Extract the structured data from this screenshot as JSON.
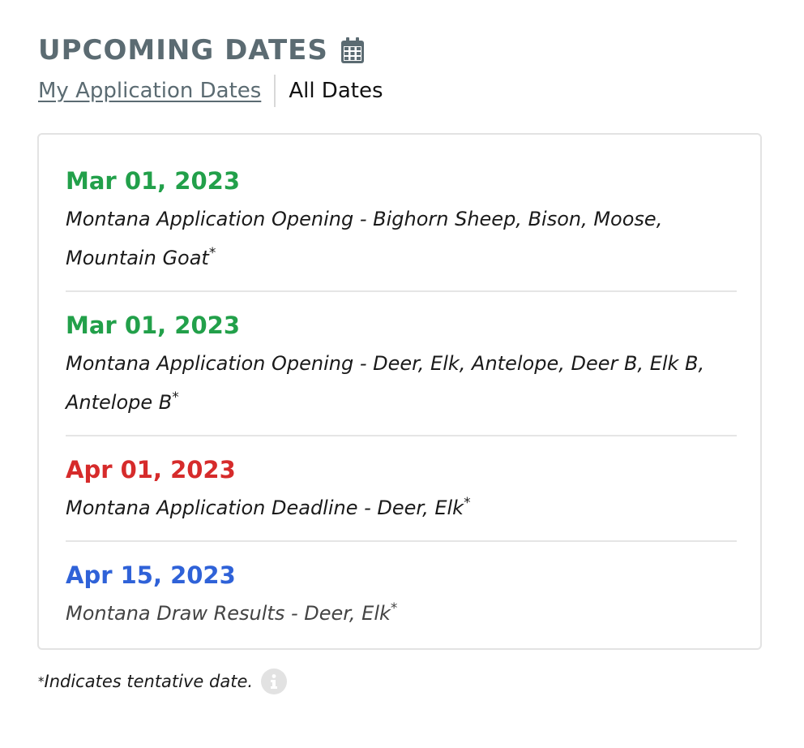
{
  "header": {
    "title": "UPCOMING DATES",
    "icon": "calendar-icon"
  },
  "tabs": {
    "my_dates_label": "My Application Dates",
    "all_dates_label": "All Dates",
    "active": "All Dates"
  },
  "colors": {
    "title": "#5b6b72",
    "opening": "#22a04a",
    "deadline": "#d62b2b",
    "results": "#2f62d8"
  },
  "entries": [
    {
      "date": "Mar 01, 2023",
      "description": "Montana Application Opening - Bighorn Sheep, Bison, Moose, Mountain Goat",
      "marker": "*",
      "kind": "opening"
    },
    {
      "date": "Mar 01, 2023",
      "description": "Montana Application Opening - Deer, Elk, Antelope, Deer B, Elk B, Antelope B",
      "marker": "*",
      "kind": "opening"
    },
    {
      "date": "Apr 01, 2023",
      "description": "Montana Application Deadline - Deer, Elk",
      "marker": "*",
      "kind": "deadline"
    },
    {
      "date": "Apr 15, 2023",
      "description": "Montana Draw Results - Deer, Elk",
      "marker": "*",
      "kind": "results"
    }
  ],
  "footnote": {
    "marker": "*",
    "text": "Indicates tentative date.",
    "icon": "info-icon"
  }
}
